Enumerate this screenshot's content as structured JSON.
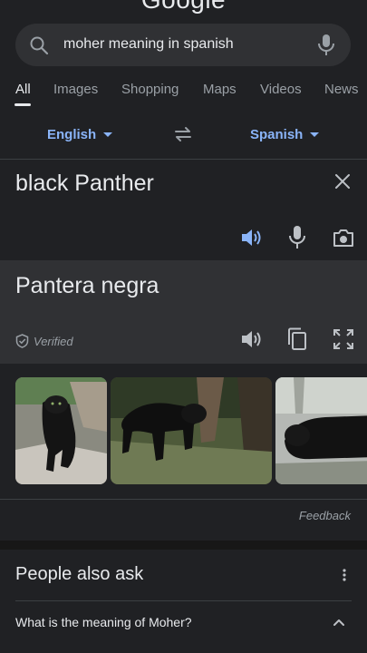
{
  "header": {
    "logo_text": "Google"
  },
  "search": {
    "query": "moher meaning in spanish"
  },
  "tabs": [
    {
      "label": "All",
      "active": true
    },
    {
      "label": "Images"
    },
    {
      "label": "Shopping"
    },
    {
      "label": "Maps"
    },
    {
      "label": "Videos"
    },
    {
      "label": "News"
    }
  ],
  "translate": {
    "source_language": "English",
    "target_language": "Spanish",
    "source_text": "black Panther",
    "translated_text": "Pantera negra",
    "verified_label": "Verified"
  },
  "images": [
    {
      "name": "panther-image-1",
      "alt": "black panther walking on rocks"
    },
    {
      "name": "panther-image-2",
      "alt": "black panther in grass"
    },
    {
      "name": "panther-image-3",
      "alt": "black panther lying down"
    }
  ],
  "feedback_label": "Feedback",
  "people_also_ask": {
    "title": "People also ask",
    "questions": [
      "What is the meaning of Moher?"
    ]
  },
  "colors": {
    "background": "#202124",
    "panel": "#303134",
    "accent": "#8ab4f8",
    "text": "#e8eaed",
    "muted": "#9aa0a6"
  }
}
